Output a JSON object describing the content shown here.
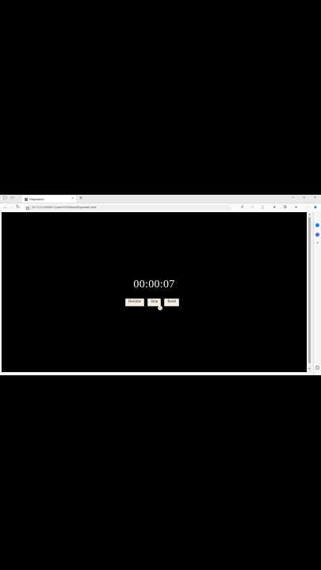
{
  "browser": {
    "tab_title": "Stopwatch",
    "tab_close": "×",
    "new_tab": "+",
    "url": "127.0.0.1:5500/F:/Users/%20Stack/Stopwatch.html",
    "back": "←",
    "forward": "→",
    "refresh": "↻"
  },
  "stopwatch": {
    "time": "00:00:07",
    "buttons": {
      "resume": "Resume",
      "stop": "Stop",
      "reset": "Reset"
    }
  },
  "colors": {
    "page_background": "#000000",
    "button_background": "#f4efe2",
    "time_text": "#ffffff"
  }
}
